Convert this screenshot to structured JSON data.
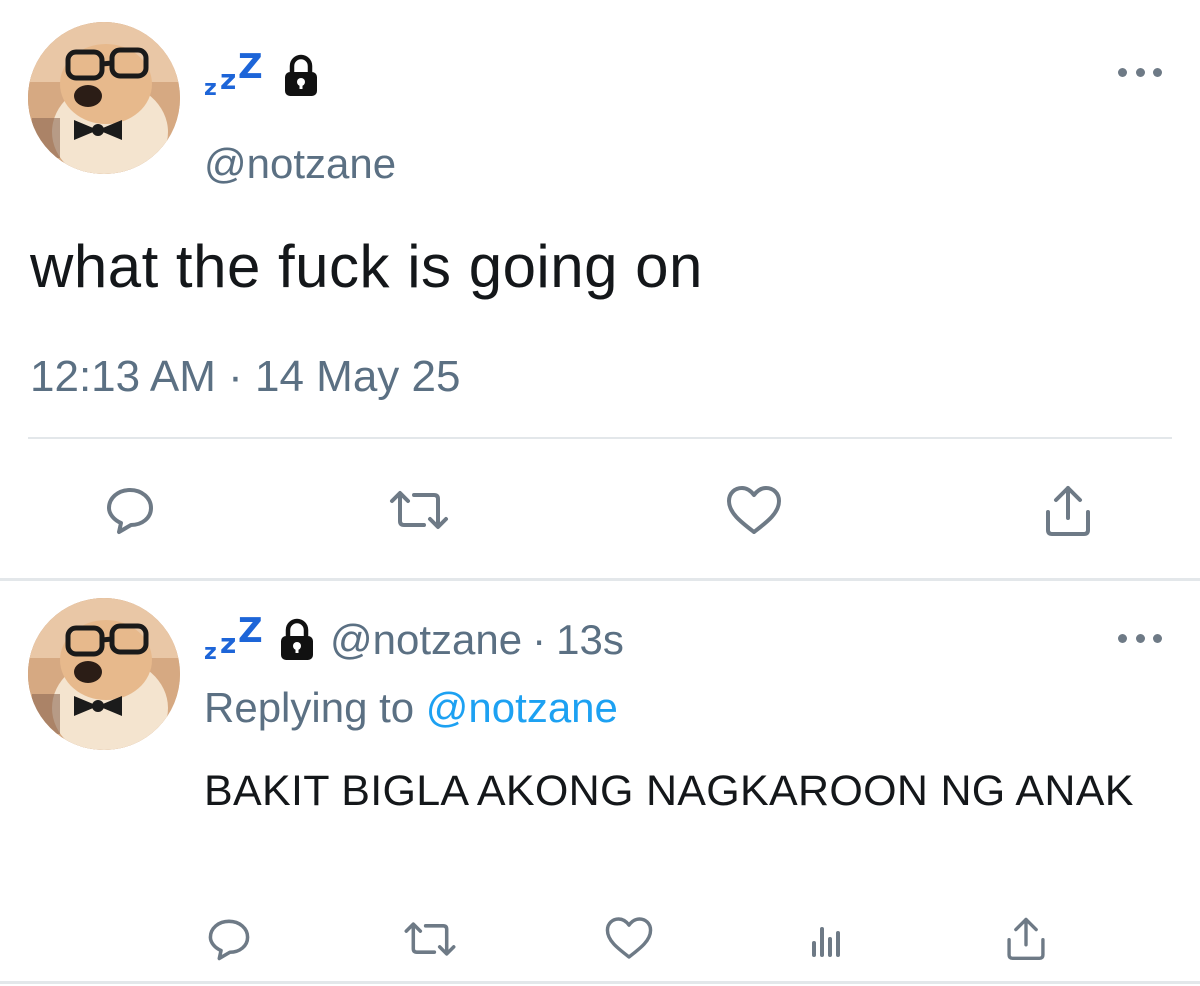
{
  "main_tweet": {
    "display_name_icon": "zzz-emoji",
    "protected_icon": "lock-icon",
    "handle": "@notzane",
    "text": "what the fuck is going on",
    "timestamp": "12:13 AM · 14 May 25",
    "actions": [
      "reply-icon",
      "retweet-icon",
      "like-icon",
      "share-icon"
    ]
  },
  "reply_tweet": {
    "display_name_icon": "zzz-emoji",
    "protected_icon": "lock-icon",
    "handle": "@notzane",
    "separator": "·",
    "age": "13s",
    "replying_prefix": "Replying to",
    "replying_to": "@notzane",
    "text": "BAKIT BIGLA AKONG NAGKAROON NG ANAK",
    "actions": [
      "reply-icon",
      "retweet-icon",
      "like-icon",
      "analytics-icon",
      "share-icon"
    ]
  },
  "zzz": {
    "small": "z",
    "mid": "z",
    "large": "Z"
  },
  "colors": {
    "accent": "#1da1f2",
    "secondary_text": "#5b7083",
    "primary_text": "#14171a",
    "icon": "#6e7a86",
    "divider": "#e3e7ea",
    "zzz_blue": "#1d65d8"
  }
}
